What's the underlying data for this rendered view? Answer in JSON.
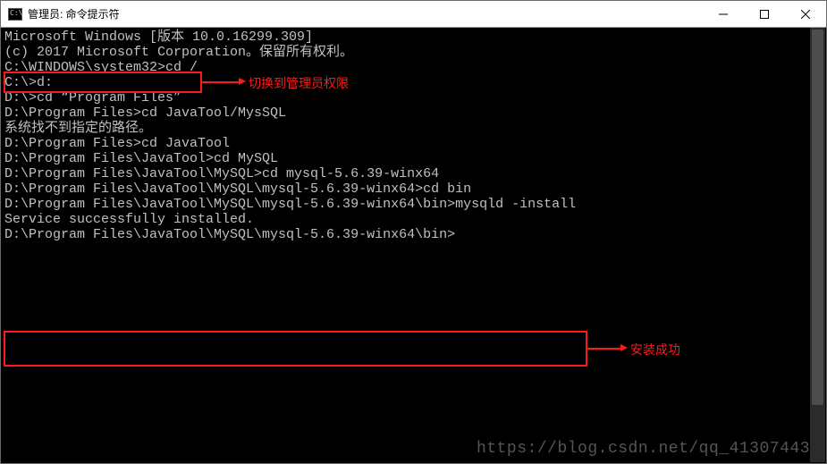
{
  "window": {
    "title": "管理员: 命令提示符",
    "icon_glyph": "C:\\"
  },
  "terminal": {
    "lines": [
      "Microsoft Windows [版本 10.0.16299.309]",
      "(c) 2017 Microsoft Corporation。保留所有权利。",
      "",
      "C:\\WINDOWS\\system32>cd /",
      "",
      "C:\\>d:",
      "",
      "D:\\>cd “Program Files”",
      "",
      "D:\\Program Files>cd JavaTool/MysSQL",
      "系统找不到指定的路径。",
      "",
      "D:\\Program Files>cd JavaTool",
      "",
      "D:\\Program Files\\JavaTool>cd MySQL",
      "",
      "D:\\Program Files\\JavaTool\\MySQL>cd mysql-5.6.39-winx64",
      "",
      "D:\\Program Files\\JavaTool\\MySQL\\mysql-5.6.39-winx64>cd bin",
      "",
      "D:\\Program Files\\JavaTool\\MySQL\\mysql-5.6.39-winx64\\bin>mysqld -install",
      "Service successfully installed.",
      "",
      "D:\\Program Files\\JavaTool\\MySQL\\mysql-5.6.39-winx64\\bin>"
    ]
  },
  "annotations": {
    "box1_label": "切换到管理员权限",
    "box2_label": "安装成功"
  },
  "watermark": "https://blog.csdn.net/qq_41307443"
}
